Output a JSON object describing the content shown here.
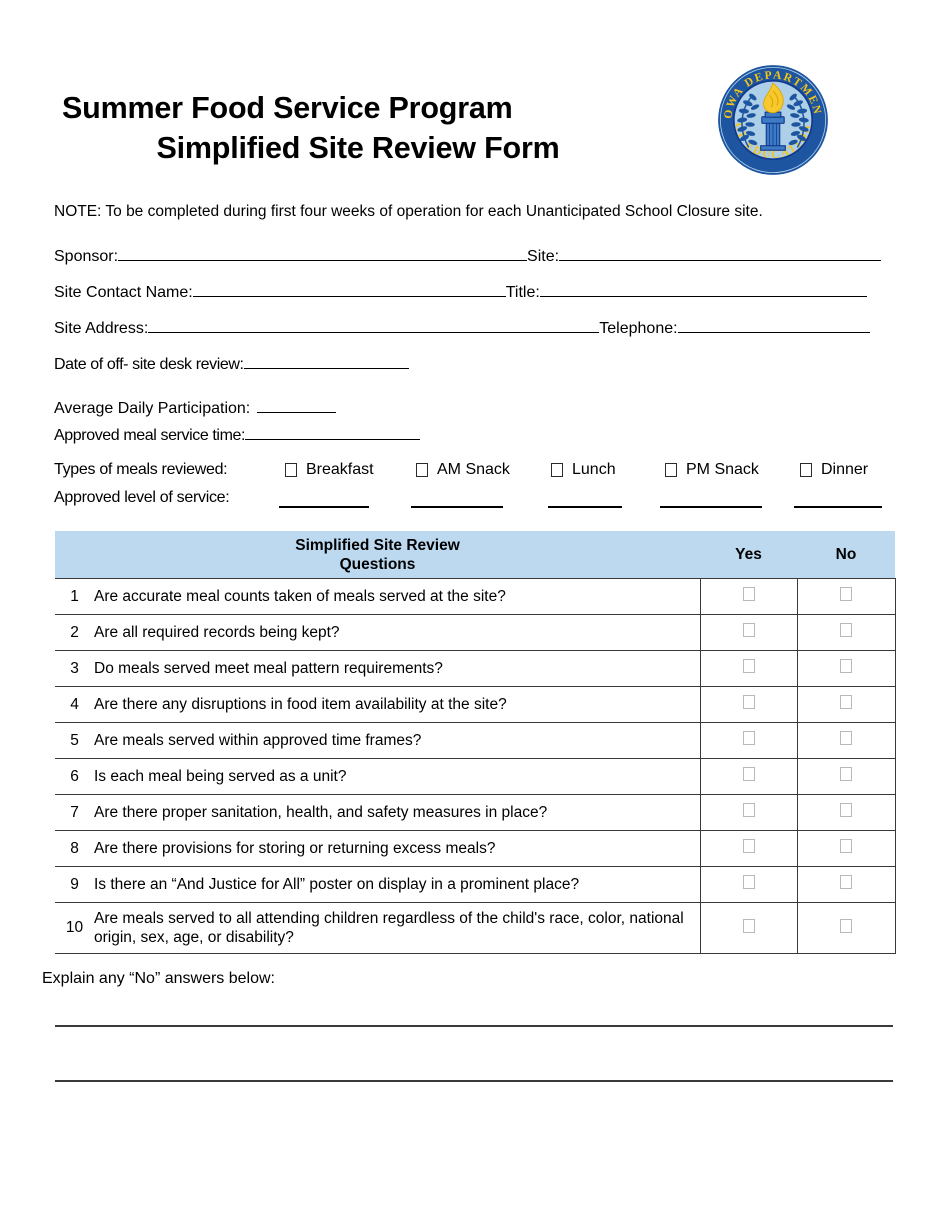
{
  "document": {
    "title_line1": "Summer Food Service Program",
    "title_line2": "Simplified Site Review Form",
    "note": "NOTE: To be completed during first four weeks of operation for each Unanticipated School Closure site."
  },
  "seal": {
    "name": "iowa-department-of-education-seal",
    "text_top": "IOWA DEPARTMENT",
    "text_bottom": "OF EDUCATION",
    "ring_color": "#1d55a0",
    "field_color": "#aecfe8",
    "text_color": "#f2c41a",
    "flame_color": "#f7c92e"
  },
  "fields": {
    "sponsor_label": "Sponsor:",
    "site_label": "Site:",
    "site_contact_label": "Site Contact Name:",
    "title_label": "Title:",
    "site_address_label": "Site Address:",
    "telephone_label": "Telephone:",
    "offsite_review_label": "Date of off- site desk review:",
    "adp_label": "Average Daily Participation:",
    "meal_service_time_label": "Approved meal service time:",
    "types_label": "Types of meals reviewed:",
    "service_level_label": "Approved level of service:",
    "value_sponsor": "",
    "value_site": "",
    "value_site_contact": "",
    "value_title": "",
    "value_site_address": "",
    "value_telephone": "",
    "value_offsite_review": "",
    "value_adp": "",
    "value_meal_service_time": ""
  },
  "meal_types": [
    {
      "label": "Breakfast",
      "checked": false,
      "service_level": ""
    },
    {
      "label": "AM Snack",
      "checked": false,
      "service_level": ""
    },
    {
      "label": "Lunch",
      "checked": false,
      "service_level": ""
    },
    {
      "label": "PM Snack",
      "checked": false,
      "service_level": ""
    },
    {
      "label": "Dinner",
      "checked": false,
      "service_level": ""
    }
  ],
  "table": {
    "header_questions_line1": "Simplified Site Review",
    "header_questions_line2": "Questions",
    "header_yes": "Yes",
    "header_no": "No",
    "header_bg": "#bcd9f0",
    "rows": [
      {
        "num": "1",
        "question": "Are accurate meal counts taken of meals served at the site?",
        "yes": false,
        "no": false
      },
      {
        "num": "2",
        "question": "Are all required records being kept?",
        "yes": false,
        "no": false
      },
      {
        "num": "3",
        "question": "Do meals served meet meal pattern requirements?",
        "yes": false,
        "no": false
      },
      {
        "num": "4",
        "question": "Are there any disruptions in food item availability at the site?",
        "yes": false,
        "no": false
      },
      {
        "num": "5",
        "question": "Are meals served within approved time frames?",
        "yes": false,
        "no": false
      },
      {
        "num": "6",
        "question": "Is each meal being served as a unit?",
        "yes": false,
        "no": false
      },
      {
        "num": "7",
        "question": "Are there proper sanitation, health, and safety measures in place?",
        "yes": false,
        "no": false
      },
      {
        "num": "8",
        "question": "Are there provisions for storing or returning excess meals?",
        "yes": false,
        "no": false
      },
      {
        "num": "9",
        "question": "Is there an “And Justice for All” poster on display in a prominent place?",
        "yes": false,
        "no": false
      },
      {
        "num": "10",
        "question": "Are meals served to all attending children regardless of the child's race, color, national origin, sex, age, or disability?",
        "yes": false,
        "no": false
      }
    ]
  },
  "explain": {
    "label": "Explain any “No” answers below:",
    "answer_line_1": "",
    "answer_line_2": ""
  }
}
